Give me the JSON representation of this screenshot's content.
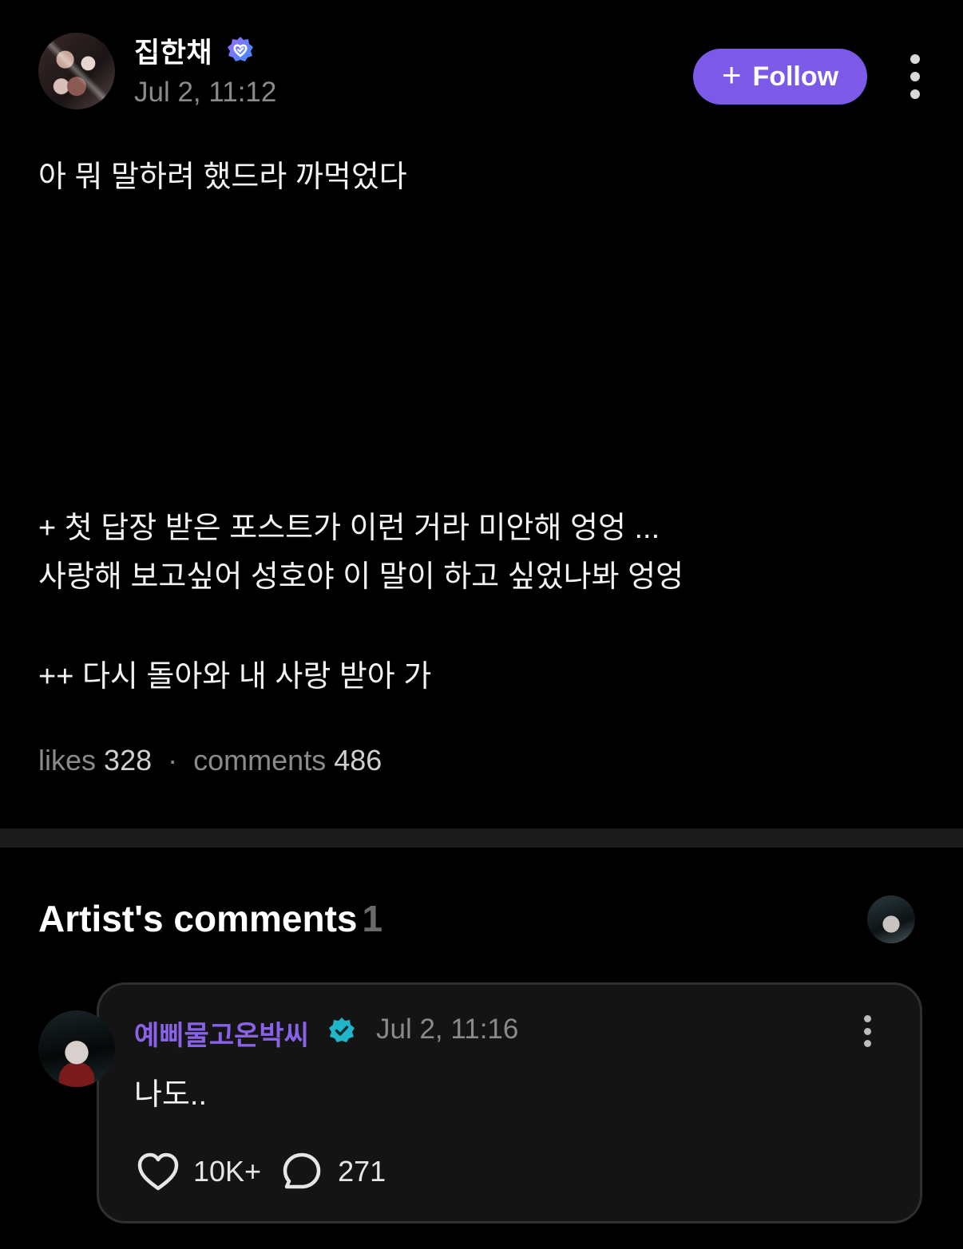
{
  "post": {
    "author_name": "집한채",
    "timestamp": "Jul 2, 11:12",
    "follow_label": "Follow",
    "lines": {
      "first": "아 뭐 말하려 했드라 까먹었다",
      "second": "+ 첫 답장 받은 포스트가 이런 거라 미안해 엉엉 ...",
      "third": "사랑해 보고싶어 성호야 이 말이 하고 싶었나봐 엉엉",
      "fourth": "++ 다시 돌아와 내 사랑 받아 가"
    },
    "stats": {
      "likes_label": "likes",
      "likes_count": "328",
      "separator": "·",
      "comments_label": "comments",
      "comments_count": "486"
    }
  },
  "artist_comments": {
    "title": "Artist's comments",
    "count": "1",
    "comment": {
      "author": "예삐물고온박씨",
      "timestamp": "Jul 2, 11:16",
      "text": "나도..",
      "likes": "10K+",
      "replies": "271"
    }
  },
  "icons": {
    "verified_post": "verified-heart-badge",
    "verified_comment": "verified-check-badge",
    "more": "kebab-icon",
    "like": "heart-icon",
    "reply": "speech-bubble-icon"
  },
  "colors": {
    "background": "#000000",
    "accent": "#7c59e6",
    "artist_name": "#8a62ea",
    "verified_teal": "#1fb6c9",
    "muted_text": "#8a8a8a"
  }
}
